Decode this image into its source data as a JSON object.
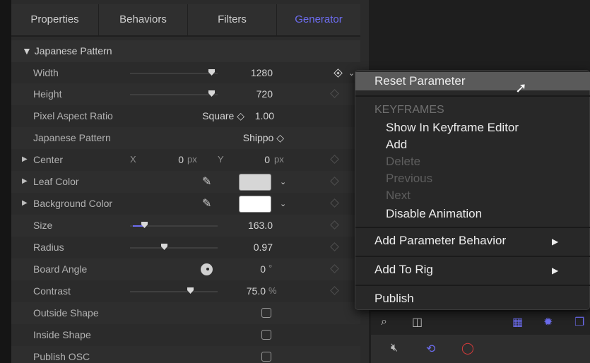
{
  "tabs": [
    "Properties",
    "Behaviors",
    "Filters",
    "Generator"
  ],
  "active_tab": "Generator",
  "section": {
    "title": "Japanese Pattern"
  },
  "params": {
    "width": {
      "label": "Width",
      "value": "1280"
    },
    "height": {
      "label": "Height",
      "value": "720"
    },
    "pixel_aspect": {
      "label": "Pixel Aspect Ratio",
      "option": "Square ◇",
      "value": "1.00"
    },
    "pattern": {
      "label": "Japanese Pattern",
      "option": "Shippo ◇"
    },
    "center": {
      "label": "Center",
      "x_label": "X",
      "x_value": "0",
      "x_unit": "px",
      "y_label": "Y",
      "y_value": "0",
      "y_unit": "px"
    },
    "leaf_color": {
      "label": "Leaf Color",
      "swatch": "#d6d6d6"
    },
    "background_color": {
      "label": "Background Color",
      "swatch": "#ffffff"
    },
    "size": {
      "label": "Size",
      "value": "163.0"
    },
    "radius": {
      "label": "Radius",
      "value": "0.97"
    },
    "board_angle": {
      "label": "Board Angle",
      "value": "0",
      "unit": "°"
    },
    "contrast": {
      "label": "Contrast",
      "value": "75.0",
      "unit": "%"
    },
    "outside_shape": {
      "label": "Outside Shape"
    },
    "inside_shape": {
      "label": "Inside Shape"
    },
    "publish_osc": {
      "label": "Publish OSC"
    }
  },
  "context_menu": {
    "reset": "Reset Parameter",
    "keyframes_header": "KEYFRAMES",
    "show_in_editor": "Show In Keyframe Editor",
    "add": "Add",
    "delete": "Delete",
    "previous": "Previous",
    "next": "Next",
    "disable_animation": "Disable Animation",
    "add_param_behavior": "Add Parameter Behavior",
    "add_to_rig": "Add To Rig",
    "publish": "Publish"
  },
  "colors": {
    "accent": "#6d6df0",
    "warning_red": "#d43a3a"
  }
}
